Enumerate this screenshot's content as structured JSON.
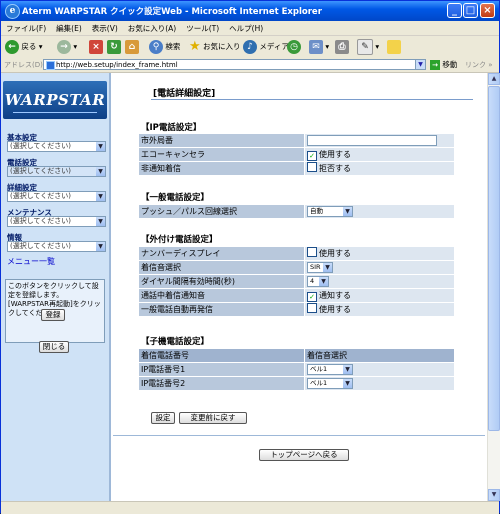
{
  "window": {
    "title": "Aterm WARPSTAR クイック設定Web - Microsoft Internet Explorer"
  },
  "menu": [
    "ファイル(F)",
    "編集(E)",
    "表示(V)",
    "お気に入り(A)",
    "ツール(T)",
    "ヘルプ(H)"
  ],
  "toolbar": {
    "back": "戻る",
    "search": "検索",
    "favorites": "お気に入り",
    "media": "メディア"
  },
  "address": {
    "label": "アドレス(D)",
    "url": "http://web.setup/index_frame.html",
    "go": "移動",
    "links": "リンク"
  },
  "sidebar": {
    "logo": "WARPSTAR",
    "groups": [
      {
        "label": "基本設定",
        "value": "(選択してください)"
      },
      {
        "label": "電話設定",
        "value": "(選択してください)"
      },
      {
        "label": "詳細設定",
        "value": "(選択してください)"
      },
      {
        "label": "メンテナンス",
        "value": "(選択してください)"
      },
      {
        "label": "情報",
        "value": "(選択してください)"
      }
    ],
    "menu_link": "メニュー一覧",
    "note": "このボタンをクリックして設定を登録します。[WARPSTAR再起動]をクリックしてください。",
    "register_button": "登録",
    "close_button": "閉じる"
  },
  "page": {
    "title": "[電話詳細設定]",
    "sections": {
      "ip": {
        "title": "【IP電話設定】",
        "rows": [
          {
            "label": "市外局番"
          },
          {
            "label": "エコーキャンセラ",
            "checkbox": "使用する",
            "checked": true
          },
          {
            "label": "非通知着信",
            "checkbox": "拒否する",
            "checked": false
          }
        ]
      },
      "general": {
        "title": "【一般電話設定】",
        "rows": [
          {
            "label": "プッシュ／パルス回線選択",
            "select": "自動"
          }
        ]
      },
      "external": {
        "title": "【外付け電話設定】",
        "rows": [
          {
            "label": "ナンバーディスプレイ",
            "checkbox": "使用する",
            "checked": false
          },
          {
            "label": "着信音選択",
            "select": "SIR"
          },
          {
            "label": "ダイヤル間隔有効時間(秒)",
            "select": "4"
          },
          {
            "label": "通話中着信通知音",
            "checkbox": "通知する",
            "checked": true
          },
          {
            "label": "一般電話自動再発信",
            "checkbox": "使用する",
            "checked": false
          }
        ]
      },
      "handset": {
        "title": "【子機電話設定】",
        "header": [
          "着信電話番号",
          "着信音選択"
        ],
        "rows": [
          {
            "label": "IP電話番号1",
            "select": "ベル1"
          },
          {
            "label": "IP電話番号2",
            "select": "ベル1"
          }
        ]
      }
    },
    "set_button": "設定",
    "reset_button": "変更前に戻す",
    "top_button": "トップページへ戻る"
  }
}
